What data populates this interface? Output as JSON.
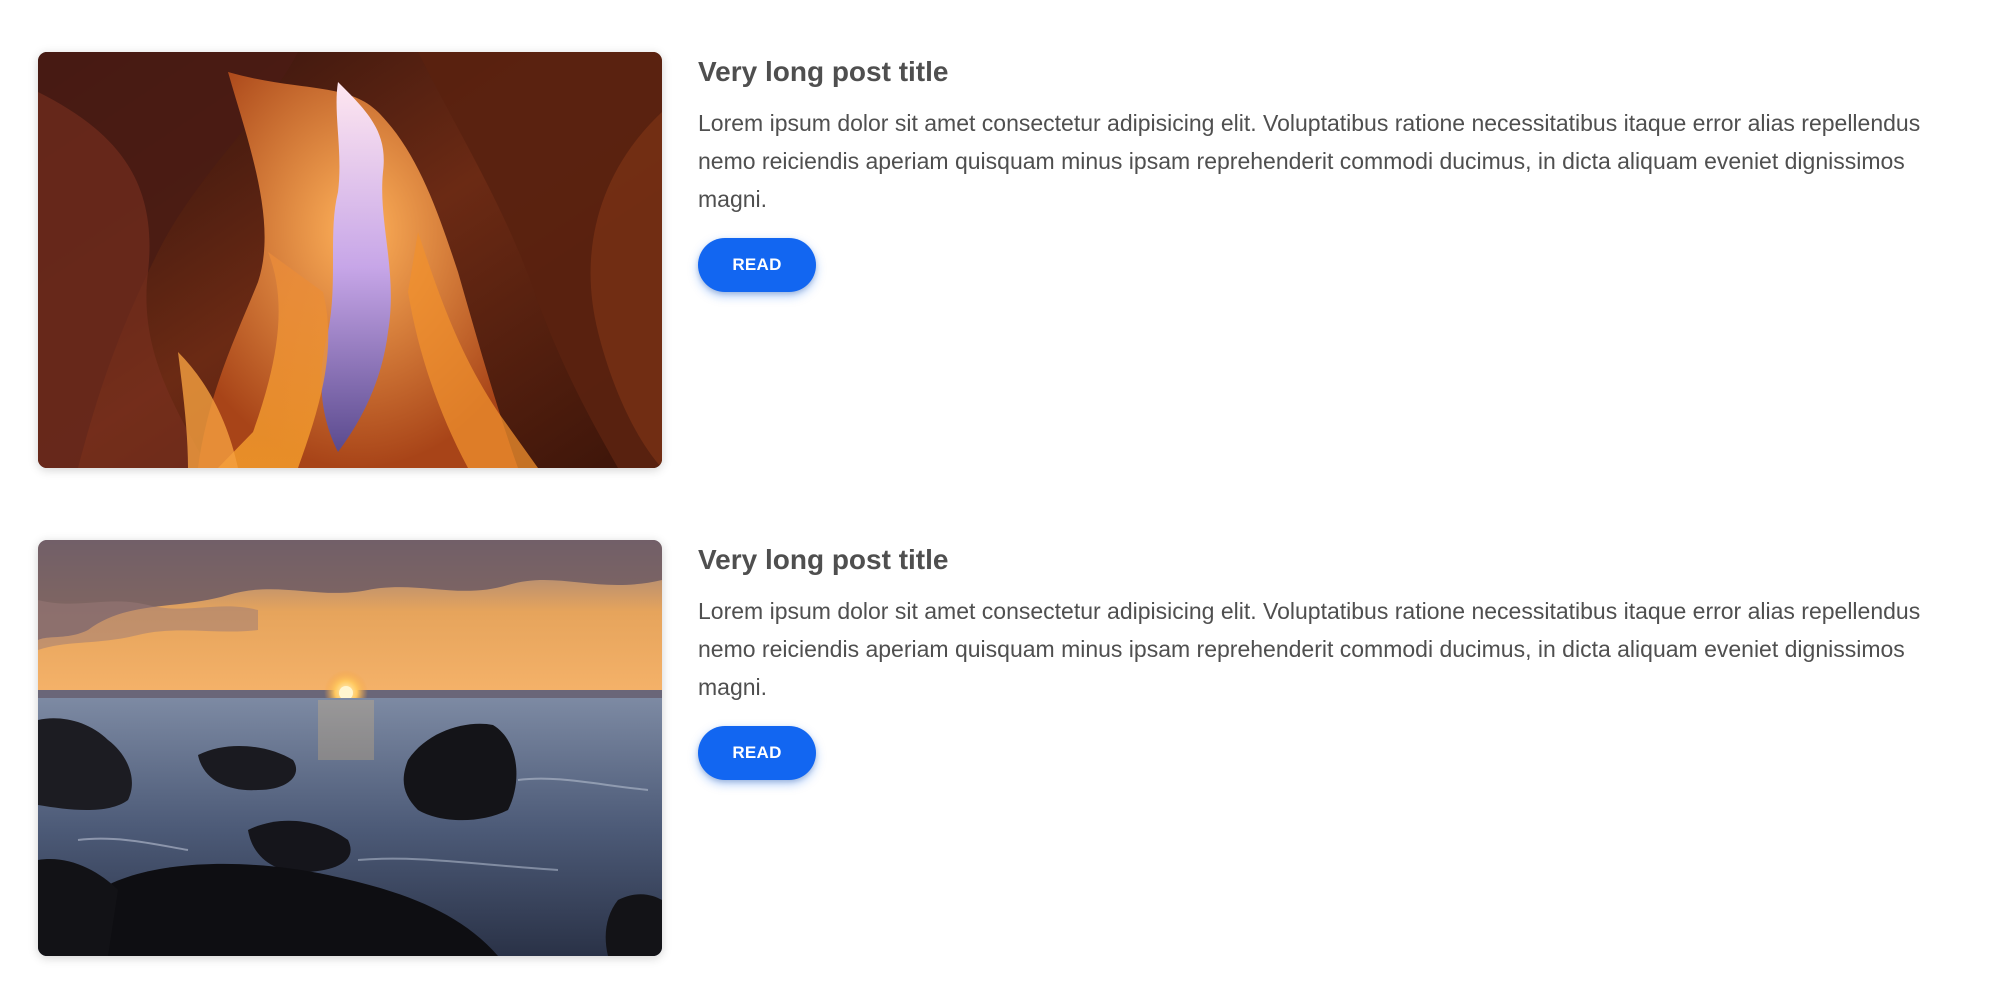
{
  "posts": [
    {
      "image": "canyon-photo",
      "title": "Very long post title",
      "body": "Lorem ipsum dolor sit amet consectetur adipisicing elit. Voluptatibus ratione necessitatibus itaque error alias repellendus nemo reiciendis aperiam quisquam minus ipsam reprehenderit commodi ducimus, in dicta aliquam eveniet dignissimos magni.",
      "button_label": "READ"
    },
    {
      "image": "sunset-sea-photo",
      "title": "Very long post title",
      "body": "Lorem ipsum dolor sit amet consectetur adipisicing elit. Voluptatibus ratione necessitatibus itaque error alias repellendus nemo reiciendis aperiam quisquam minus ipsam reprehenderit commodi ducimus, in dicta aliquam eveniet dignissimos magni.",
      "button_label": "READ"
    }
  ],
  "colors": {
    "accent": "#1266f1",
    "text": "#4f4f4f",
    "background": "#ffffff"
  }
}
